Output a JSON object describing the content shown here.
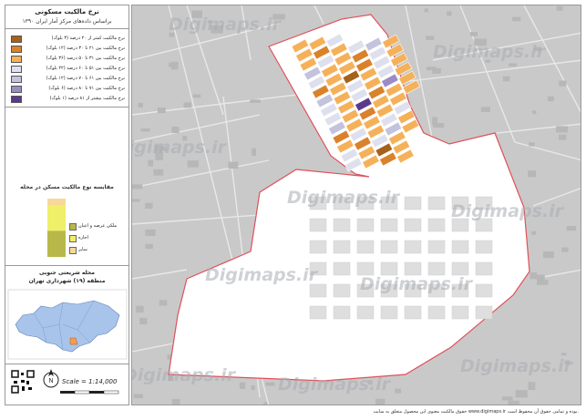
{
  "map": {
    "title": "نرخ مالکیت مسکونی",
    "subtitle": "براساس داده‌های مرکز آمار ایران ۱۳۹۰",
    "legend": [
      {
        "label": "نرخ مالکیت کمتر از ۲۰ درصد (۳ بلوک)",
        "color": "#a6611a"
      },
      {
        "label": "نرخ مالکیت بین ۲۱ تا ۳۰ درصد (۱۲ بلوک)",
        "color": "#d9822b"
      },
      {
        "label": "نرخ مالکیت بین ۳۱ تا ۵۰ درصد (۳۶ بلوک)",
        "color": "#f5b15a"
      },
      {
        "label": "نرخ مالکیت بین ۵۱ تا ۶۰ درصد (۲۲ بلوک)",
        "color": "#dfe0ee"
      },
      {
        "label": "نرخ مالکیت بین ۶۱ تا ۷۰ درصد (۱۲ بلوک)",
        "color": "#c3c3de"
      },
      {
        "label": "نرخ مالکیت بین ۷۱ تا ۸۰ درصد (۶ بلوک)",
        "color": "#9b8cc4"
      },
      {
        "label": "نرخ مالکیت بیشتر از ۸۱ درصد (۱ بلوک)",
        "color": "#5b3a8c"
      }
    ],
    "chart_title": "مقایسه نوع مالکیت مسکن در محله",
    "chart_legend": [
      {
        "label": "ملکی عرصه و اعیان",
        "color": "#b8b84a"
      },
      {
        "label": "اجاره",
        "color": "#f0ef6a"
      },
      {
        "label": "سایر",
        "color": "#f7d89a"
      }
    ],
    "location_title": "محله شریعتی جنوبی",
    "location_subtitle": "منطقه (۱۹) شهرداری تهران",
    "scale": "Scale = 1:14,000",
    "north": "N",
    "watermark": "Digimaps.ir",
    "copyright": "حقوق مالکیت معنوی این محصول متعلق به سایت www.digimaps.ir بوده و تمامی حقوق آن محفوظ است."
  },
  "chart_data": {
    "type": "bar",
    "categories": [
      "ملکی عرصه و اعیان",
      "اجاره",
      "سایر"
    ],
    "values": [
      45,
      43,
      12
    ],
    "stacked": true
  },
  "colors": {
    "boundary": "#e0505a",
    "park": "#ffffff",
    "basemap": "#c9c9c9"
  }
}
